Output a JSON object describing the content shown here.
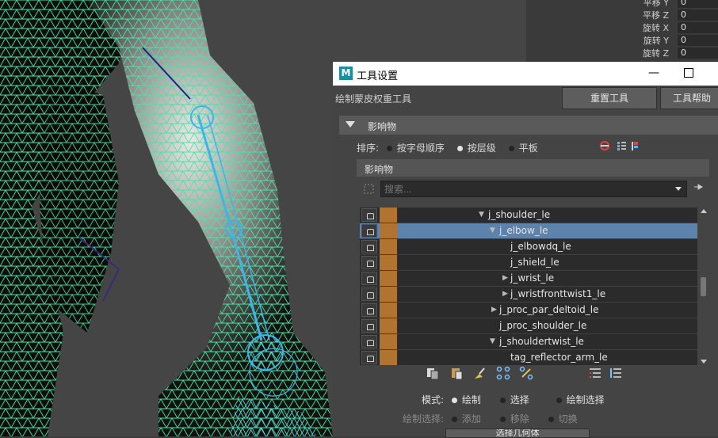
{
  "channel_box": {
    "rows": [
      {
        "label": "平移 Y",
        "value": "0"
      },
      {
        "label": "平移 Z",
        "value": "0"
      },
      {
        "label": "旋转 X",
        "value": "0"
      },
      {
        "label": "旋转 Y",
        "value": "0"
      },
      {
        "label": "旋转 Z",
        "value": "0"
      }
    ]
  },
  "window": {
    "app_icon": "M",
    "title": "工具设置",
    "minimize_glyph": "—",
    "tool_name": "绘制蒙皮权重工具",
    "reset_button": "重置工具",
    "help_button": "工具帮助",
    "section_title": "影响物",
    "sort_label": "排序:",
    "sort_options": [
      "按字母顺序",
      "按层级",
      "平板"
    ],
    "sort_selected": "按层级",
    "influences_header": "影响物",
    "search_placeholder": "搜索..."
  },
  "influences": [
    {
      "name": "j_shoulder_le",
      "expander": "collapse"
    },
    {
      "name": "j_elbow_le",
      "expander": "collapse",
      "selected": true
    },
    {
      "name": "j_elbowdq_le",
      "expander": ""
    },
    {
      "name": "j_shield_le",
      "expander": ""
    },
    {
      "name": "j_wrist_le",
      "expander": "expand"
    },
    {
      "name": "j_wristfronttwist1_le",
      "expander": "expand"
    },
    {
      "name": "j_proc_par_deltoid_le",
      "expander": "expand"
    },
    {
      "name": "j_proc_shoulder_le",
      "expander": ""
    },
    {
      "name": "j_shouldertwist_le",
      "expander": "collapse"
    },
    {
      "name": "tag_reflector_arm_le",
      "expander": ""
    }
  ],
  "mode": {
    "label": "模式:",
    "options": [
      "绘制",
      "选择",
      "绘制选择"
    ],
    "selected": "绘制"
  },
  "paint_select": {
    "label": "绘制选择:",
    "options": [
      "添加",
      "移除",
      "切换"
    ]
  },
  "bottom_button": "选择几何体",
  "colors": {
    "joint_swatch": "#b07430",
    "selection": "#5d82ab",
    "wireframe": "#45e6a0",
    "bones": "#3fb4e6"
  }
}
